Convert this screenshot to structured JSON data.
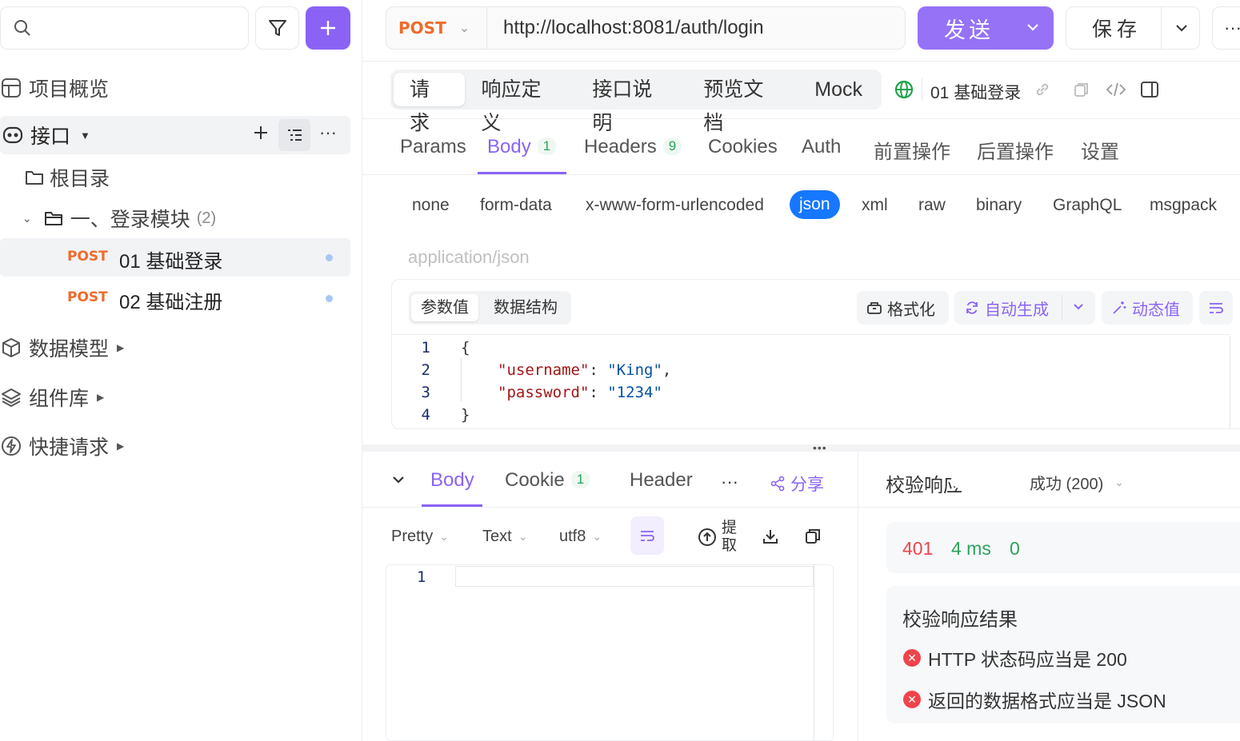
{
  "sidebar": {
    "search_placeholder": "",
    "nav": {
      "overview": "项目概览",
      "interfaces": "接口",
      "root": "根目录",
      "folder": "一、登录模块",
      "folder_count": "(2)",
      "data_models": "数据模型",
      "components": "组件库",
      "quick_requests": "快捷请求"
    },
    "endpoints": [
      {
        "method": "POST",
        "name": "01 基础登录"
      },
      {
        "method": "POST",
        "name": "02 基础注册"
      }
    ]
  },
  "topbar": {
    "method": "POST",
    "url": "http://localhost:8081/auth/login",
    "send_label": "发送",
    "save_label": "保存"
  },
  "main_tabs": [
    "请求",
    "响应定义",
    "接口说明",
    "预览文档",
    "Mock"
  ],
  "endpoint_title": "01 基础登录",
  "request_tabs": {
    "params": "Params",
    "body": "Body",
    "body_count": "1",
    "headers": "Headers",
    "headers_count": "9",
    "cookies": "Cookies",
    "auth": "Auth",
    "pre": "前置操作",
    "post": "后置操作",
    "settings": "设置"
  },
  "body_types": {
    "none": "none",
    "form_data": "form-data",
    "urlencoded": "x-www-form-urlencoded",
    "json": "json",
    "xml": "xml",
    "raw": "raw",
    "binary": "binary",
    "graphql": "GraphQL",
    "msgpack": "msgpack"
  },
  "content_type": "application/json",
  "editor": {
    "seg_values": "参数值",
    "seg_schema": "数据结构",
    "format": "格式化",
    "autogen": "自动生成",
    "dynamic": "动态值",
    "lines": [
      {
        "no": "1",
        "text": "{"
      },
      {
        "no": "2",
        "key": "\"username\"",
        "value": "\"King\"",
        "tail": ","
      },
      {
        "no": "3",
        "key": "\"password\"",
        "value": "\"1234\"",
        "tail": ""
      },
      {
        "no": "4",
        "text": "}"
      }
    ]
  },
  "response": {
    "tabs": {
      "body": "Body",
      "cookie": "Cookie",
      "cookie_count": "1",
      "header": "Header",
      "share": "分享"
    },
    "format": {
      "pretty": "Pretty",
      "text": "Text",
      "encoding": "utf8",
      "extract": "提取"
    },
    "line_no": "1"
  },
  "validation": {
    "label": "校验响应",
    "status_select": "成功 (200)",
    "status_code": "401",
    "time": "4 ms",
    "size": "0",
    "result_title": "校验响应结果",
    "errors": [
      "HTTP 状态码应当是 200",
      "返回的数据格式应当是 JSON"
    ]
  },
  "colors": {
    "accent": "#8a63f5",
    "post": "#ef6b2b",
    "active_tab": "#8a63f5",
    "json_pill": "#1677ff",
    "error": "#f0444c",
    "success": "#2aa35b"
  }
}
